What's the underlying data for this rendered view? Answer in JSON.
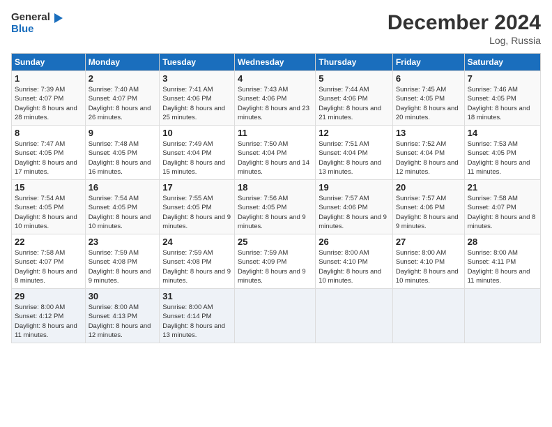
{
  "header": {
    "logo_line1": "General",
    "logo_line2": "Blue",
    "title": "December 2024",
    "location": "Log, Russia"
  },
  "weekdays": [
    "Sunday",
    "Monday",
    "Tuesday",
    "Wednesday",
    "Thursday",
    "Friday",
    "Saturday"
  ],
  "weeks": [
    [
      {
        "day": "1",
        "sunrise": "7:39 AM",
        "sunset": "4:07 PM",
        "daylight": "8 hours and 28 minutes."
      },
      {
        "day": "2",
        "sunrise": "7:40 AM",
        "sunset": "4:07 PM",
        "daylight": "8 hours and 26 minutes."
      },
      {
        "day": "3",
        "sunrise": "7:41 AM",
        "sunset": "4:06 PM",
        "daylight": "8 hours and 25 minutes."
      },
      {
        "day": "4",
        "sunrise": "7:43 AM",
        "sunset": "4:06 PM",
        "daylight": "8 hours and 23 minutes."
      },
      {
        "day": "5",
        "sunrise": "7:44 AM",
        "sunset": "4:06 PM",
        "daylight": "8 hours and 21 minutes."
      },
      {
        "day": "6",
        "sunrise": "7:45 AM",
        "sunset": "4:05 PM",
        "daylight": "8 hours and 20 minutes."
      },
      {
        "day": "7",
        "sunrise": "7:46 AM",
        "sunset": "4:05 PM",
        "daylight": "8 hours and 18 minutes."
      }
    ],
    [
      {
        "day": "8",
        "sunrise": "7:47 AM",
        "sunset": "4:05 PM",
        "daylight": "8 hours and 17 minutes."
      },
      {
        "day": "9",
        "sunrise": "7:48 AM",
        "sunset": "4:05 PM",
        "daylight": "8 hours and 16 minutes."
      },
      {
        "day": "10",
        "sunrise": "7:49 AM",
        "sunset": "4:04 PM",
        "daylight": "8 hours and 15 minutes."
      },
      {
        "day": "11",
        "sunrise": "7:50 AM",
        "sunset": "4:04 PM",
        "daylight": "8 hours and 14 minutes."
      },
      {
        "day": "12",
        "sunrise": "7:51 AM",
        "sunset": "4:04 PM",
        "daylight": "8 hours and 13 minutes."
      },
      {
        "day": "13",
        "sunrise": "7:52 AM",
        "sunset": "4:04 PM",
        "daylight": "8 hours and 12 minutes."
      },
      {
        "day": "14",
        "sunrise": "7:53 AM",
        "sunset": "4:05 PM",
        "daylight": "8 hours and 11 minutes."
      }
    ],
    [
      {
        "day": "15",
        "sunrise": "7:54 AM",
        "sunset": "4:05 PM",
        "daylight": "8 hours and 10 minutes."
      },
      {
        "day": "16",
        "sunrise": "7:54 AM",
        "sunset": "4:05 PM",
        "daylight": "8 hours and 10 minutes."
      },
      {
        "day": "17",
        "sunrise": "7:55 AM",
        "sunset": "4:05 PM",
        "daylight": "8 hours and 9 minutes."
      },
      {
        "day": "18",
        "sunrise": "7:56 AM",
        "sunset": "4:05 PM",
        "daylight": "8 hours and 9 minutes."
      },
      {
        "day": "19",
        "sunrise": "7:57 AM",
        "sunset": "4:06 PM",
        "daylight": "8 hours and 9 minutes."
      },
      {
        "day": "20",
        "sunrise": "7:57 AM",
        "sunset": "4:06 PM",
        "daylight": "8 hours and 9 minutes."
      },
      {
        "day": "21",
        "sunrise": "7:58 AM",
        "sunset": "4:07 PM",
        "daylight": "8 hours and 8 minutes."
      }
    ],
    [
      {
        "day": "22",
        "sunrise": "7:58 AM",
        "sunset": "4:07 PM",
        "daylight": "8 hours and 8 minutes."
      },
      {
        "day": "23",
        "sunrise": "7:59 AM",
        "sunset": "4:08 PM",
        "daylight": "8 hours and 9 minutes."
      },
      {
        "day": "24",
        "sunrise": "7:59 AM",
        "sunset": "4:08 PM",
        "daylight": "8 hours and 9 minutes."
      },
      {
        "day": "25",
        "sunrise": "7:59 AM",
        "sunset": "4:09 PM",
        "daylight": "8 hours and 9 minutes."
      },
      {
        "day": "26",
        "sunrise": "8:00 AM",
        "sunset": "4:10 PM",
        "daylight": "8 hours and 10 minutes."
      },
      {
        "day": "27",
        "sunrise": "8:00 AM",
        "sunset": "4:10 PM",
        "daylight": "8 hours and 10 minutes."
      },
      {
        "day": "28",
        "sunrise": "8:00 AM",
        "sunset": "4:11 PM",
        "daylight": "8 hours and 11 minutes."
      }
    ],
    [
      {
        "day": "29",
        "sunrise": "8:00 AM",
        "sunset": "4:12 PM",
        "daylight": "8 hours and 11 minutes."
      },
      {
        "day": "30",
        "sunrise": "8:00 AM",
        "sunset": "4:13 PM",
        "daylight": "8 hours and 12 minutes."
      },
      {
        "day": "31",
        "sunrise": "8:00 AM",
        "sunset": "4:14 PM",
        "daylight": "8 hours and 13 minutes."
      },
      null,
      null,
      null,
      null
    ]
  ]
}
